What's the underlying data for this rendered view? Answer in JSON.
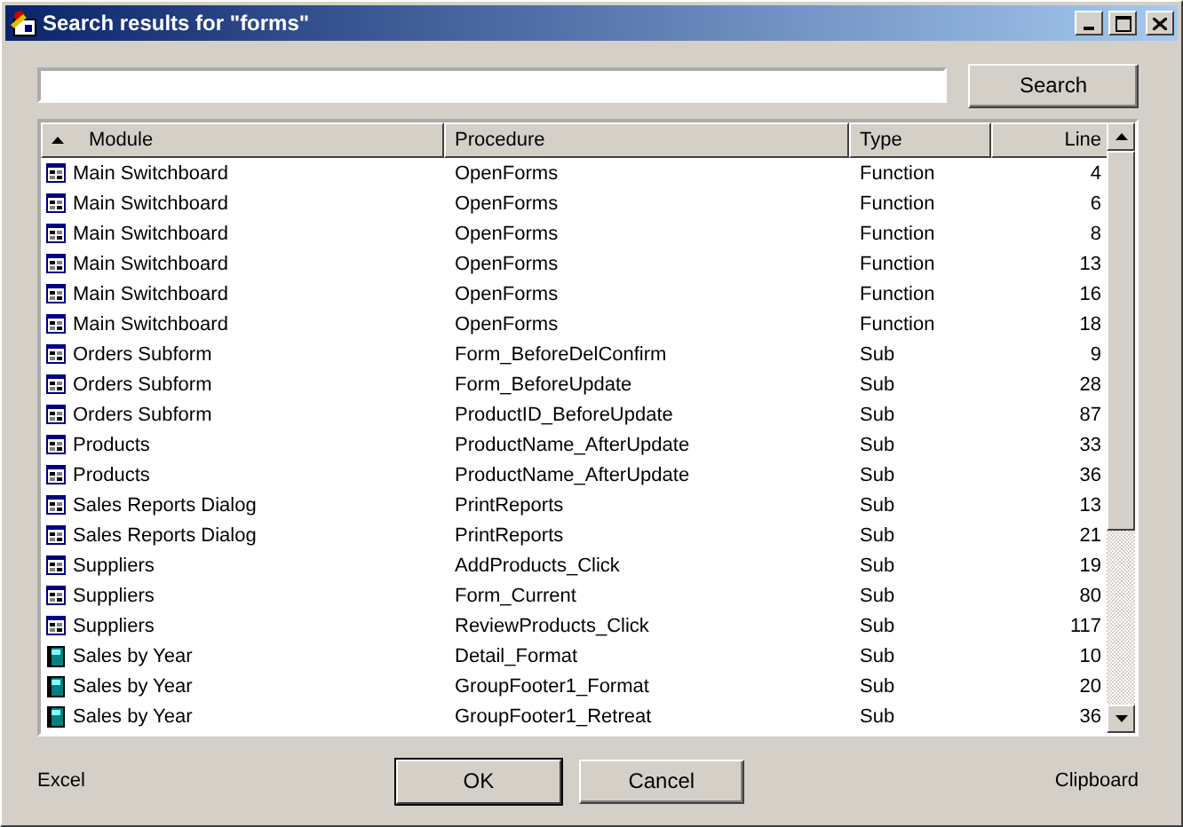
{
  "window": {
    "title": "Search results for \"forms\""
  },
  "search": {
    "button": "Search"
  },
  "table": {
    "columns": [
      {
        "label": "Module",
        "sorted": true
      },
      {
        "label": "Procedure",
        "sorted": false
      },
      {
        "label": "Type",
        "sorted": false
      },
      {
        "label": "Line",
        "sorted": false
      }
    ],
    "rows": [
      {
        "kind": "form",
        "module": "Main Switchboard",
        "procedure": "OpenForms",
        "type": "Function",
        "line": "4"
      },
      {
        "kind": "form",
        "module": "Main Switchboard",
        "procedure": "OpenForms",
        "type": "Function",
        "line": "6"
      },
      {
        "kind": "form",
        "module": "Main Switchboard",
        "procedure": "OpenForms",
        "type": "Function",
        "line": "8"
      },
      {
        "kind": "form",
        "module": "Main Switchboard",
        "procedure": "OpenForms",
        "type": "Function",
        "line": "13"
      },
      {
        "kind": "form",
        "module": "Main Switchboard",
        "procedure": "OpenForms",
        "type": "Function",
        "line": "16"
      },
      {
        "kind": "form",
        "module": "Main Switchboard",
        "procedure": "OpenForms",
        "type": "Function",
        "line": "18"
      },
      {
        "kind": "form",
        "module": "Orders Subform",
        "procedure": "Form_BeforeDelConfirm",
        "type": "Sub",
        "line": "9"
      },
      {
        "kind": "form",
        "module": "Orders Subform",
        "procedure": "Form_BeforeUpdate",
        "type": "Sub",
        "line": "28"
      },
      {
        "kind": "form",
        "module": "Orders Subform",
        "procedure": "ProductID_BeforeUpdate",
        "type": "Sub",
        "line": "87"
      },
      {
        "kind": "form",
        "module": "Products",
        "procedure": "ProductName_AfterUpdate",
        "type": "Sub",
        "line": "33"
      },
      {
        "kind": "form",
        "module": "Products",
        "procedure": "ProductName_AfterUpdate",
        "type": "Sub",
        "line": "36"
      },
      {
        "kind": "form",
        "module": "Sales Reports Dialog",
        "procedure": "PrintReports",
        "type": "Sub",
        "line": "13"
      },
      {
        "kind": "form",
        "module": "Sales Reports Dialog",
        "procedure": "PrintReports",
        "type": "Sub",
        "line": "21"
      },
      {
        "kind": "form",
        "module": "Suppliers",
        "procedure": "AddProducts_Click",
        "type": "Sub",
        "line": "19"
      },
      {
        "kind": "form",
        "module": "Suppliers",
        "procedure": "Form_Current",
        "type": "Sub",
        "line": "80"
      },
      {
        "kind": "form",
        "module": "Suppliers",
        "procedure": "ReviewProducts_Click",
        "type": "Sub",
        "line": "117"
      },
      {
        "kind": "report",
        "module": "Sales by Year",
        "procedure": "Detail_Format",
        "type": "Sub",
        "line": "10"
      },
      {
        "kind": "report",
        "module": "Sales by Year",
        "procedure": "GroupFooter1_Format",
        "type": "Sub",
        "line": "20"
      },
      {
        "kind": "report",
        "module": "Sales by Year",
        "procedure": "GroupFooter1_Retreat",
        "type": "Sub",
        "line": "36"
      }
    ]
  },
  "footer": {
    "left_link": "Excel",
    "buttons": [
      "OK",
      "Cancel"
    ],
    "right_link": "Clipboard"
  }
}
